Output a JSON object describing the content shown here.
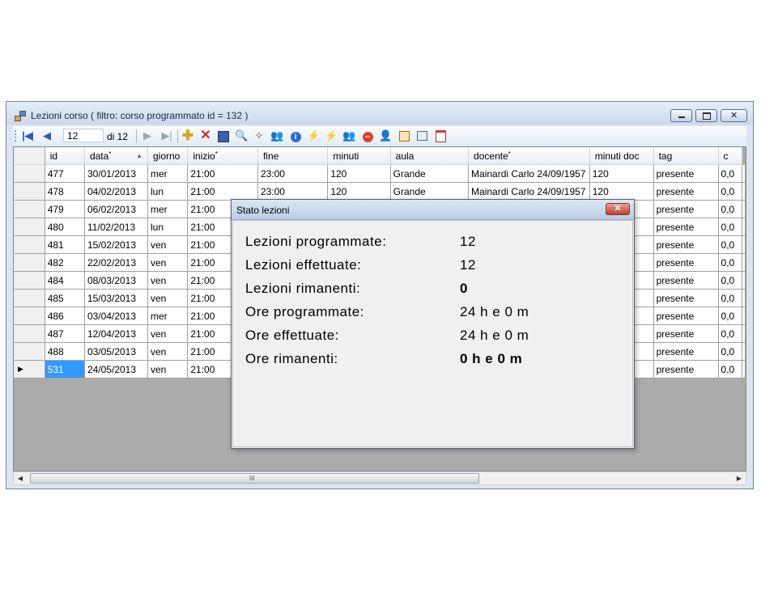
{
  "window": {
    "title": "Lezioni corso ( filtro: corso programmato id = 132 )",
    "buttons": {
      "minimize": "▭",
      "maximize": "▢",
      "close": "✕"
    }
  },
  "toolbar": {
    "position_value": "12",
    "position_total": "di 12",
    "icons": [
      "first-icon",
      "prev-icon",
      "next-icon",
      "last-icon",
      "add-icon",
      "delete-icon",
      "save-icon",
      "search-icon",
      "wand-icon",
      "users-icon",
      "info-icon",
      "lightning-icon",
      "lightning2-icon",
      "group-icon",
      "stop-icon",
      "person-icon",
      "calendar-icon",
      "export-icon",
      "schedule-icon"
    ]
  },
  "grid": {
    "columns": [
      "id",
      "data",
      "giorno",
      "inizio",
      "fine",
      "minuti",
      "aula",
      "docente",
      "minuti doc",
      "tag",
      "c"
    ],
    "rows": [
      [
        "477",
        "30/01/2013",
        "mer",
        "21:00",
        "23:00",
        "120",
        "Grande",
        "Mainardi Carlo 24/09/1957",
        "120",
        "presente",
        "0,0"
      ],
      [
        "478",
        "04/02/2013",
        "lun",
        "21:00",
        "23:00",
        "120",
        "Grande",
        "Mainardi Carlo 24/09/1957",
        "120",
        "presente",
        "0,0"
      ],
      [
        "479",
        "06/02/2013",
        "mer",
        "21:00",
        "",
        "",
        "",
        "",
        "",
        "presente",
        "0,0"
      ],
      [
        "480",
        "11/02/2013",
        "lun",
        "21:00",
        "",
        "",
        "",
        "",
        "",
        "presente",
        "0,0"
      ],
      [
        "481",
        "15/02/2013",
        "ven",
        "21:00",
        "",
        "",
        "",
        "",
        "",
        "presente",
        "0,0"
      ],
      [
        "482",
        "22/02/2013",
        "ven",
        "21:00",
        "",
        "",
        "",
        "",
        "",
        "presente",
        "0,0"
      ],
      [
        "484",
        "08/03/2013",
        "ven",
        "21:00",
        "",
        "",
        "",
        "",
        "",
        "presente",
        "0,0"
      ],
      [
        "485",
        "15/03/2013",
        "ven",
        "21:00",
        "",
        "",
        "",
        "",
        "",
        "presente",
        "0,0"
      ],
      [
        "486",
        "03/04/2013",
        "mer",
        "21:00",
        "",
        "",
        "",
        "",
        "",
        "presente",
        "0,0"
      ],
      [
        "487",
        "12/04/2013",
        "ven",
        "21:00",
        "",
        "",
        "",
        "",
        "",
        "presente",
        "0,0"
      ],
      [
        "488",
        "03/05/2013",
        "ven",
        "21:00",
        "",
        "",
        "",
        "",
        "",
        "presente",
        "0,0"
      ],
      [
        "531",
        "24/05/2013",
        "ven",
        "21:00",
        "",
        "",
        "",
        "",
        "",
        "presente",
        "0,0"
      ]
    ],
    "current_row_marker": "▶"
  },
  "scrollbar": {
    "left": "◀",
    "right": "▶",
    "grip": "III"
  },
  "dialog": {
    "title": "Stato lezioni",
    "close": "✕",
    "stats": [
      {
        "label": "Lezioni programmate:",
        "value": "12"
      },
      {
        "label": "Lezioni effettuate:",
        "value": "12"
      },
      {
        "label": "Lezioni rimanenti:",
        "value": "0"
      },
      {
        "label": "Ore programmate:",
        "value": "24 h e 0 m"
      },
      {
        "label": "Ore effettuate:",
        "value": "24 h e 0 m"
      },
      {
        "label": "Ore rimanenti:",
        "value": "0 h e 0 m"
      }
    ]
  }
}
